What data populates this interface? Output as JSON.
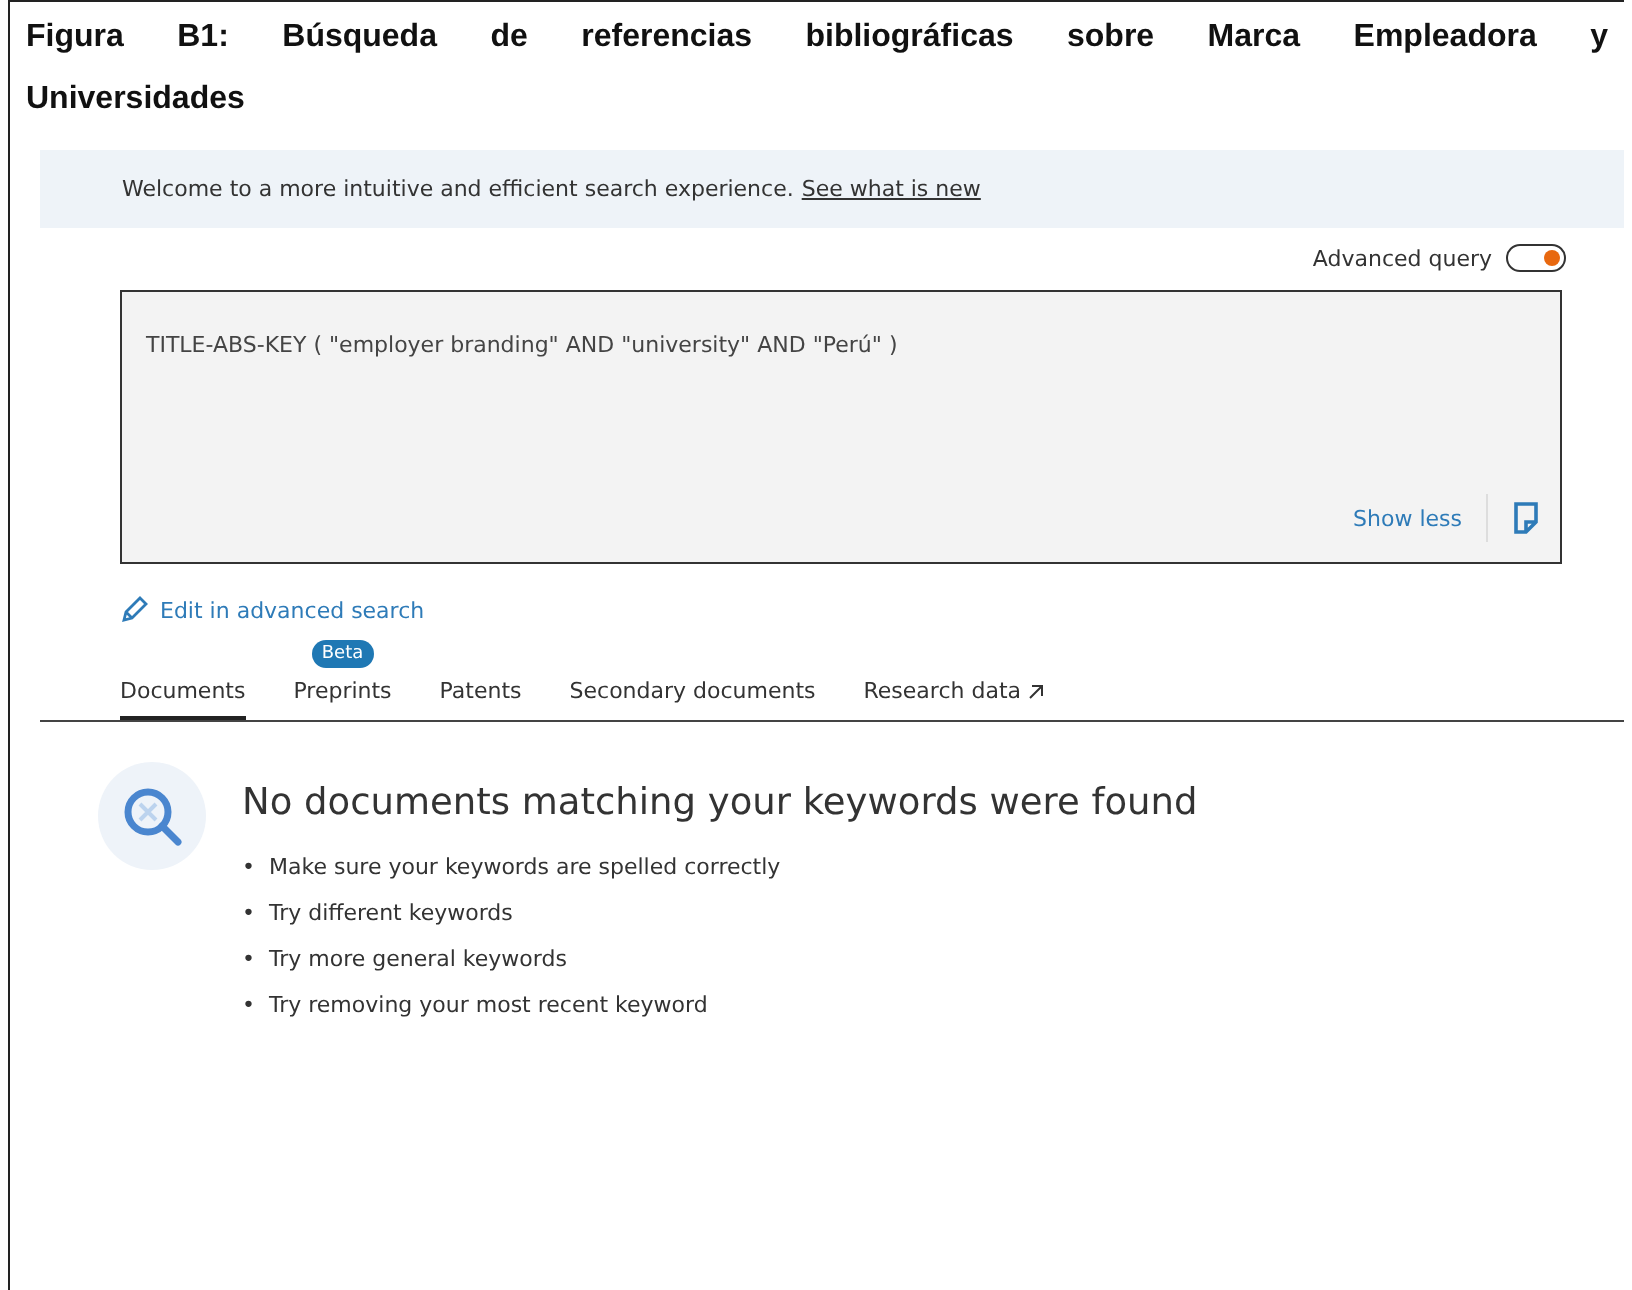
{
  "caption": "Figura B1: Búsqueda de referencias bibliográficas sobre Marca Empleadora y Universidades",
  "banner": {
    "text": "Welcome to a more intuitive and efficient search experience.",
    "link": "See what is new"
  },
  "advanced_query": {
    "label": "Advanced query",
    "on": true
  },
  "query": {
    "value": "TITLE-ABS-KEY ( \"employer branding\" AND \"university\" AND \"Perú\" )",
    "show_less": "Show less"
  },
  "edit_link": "Edit in advanced search",
  "tabs": [
    {
      "label": "Documents",
      "selected": true
    },
    {
      "label": "Preprints",
      "selected": false,
      "badge": "Beta"
    },
    {
      "label": "Patents",
      "selected": false
    },
    {
      "label": "Secondary documents",
      "selected": false
    },
    {
      "label": "Research data",
      "selected": false,
      "external": true
    }
  ],
  "empty": {
    "bullet": "•",
    "title": "No documents matching your keywords were found",
    "tips": [
      "Make sure your keywords are spelled correctly",
      "Try different keywords",
      "Try more general keywords",
      "Try removing your most recent keyword"
    ]
  }
}
